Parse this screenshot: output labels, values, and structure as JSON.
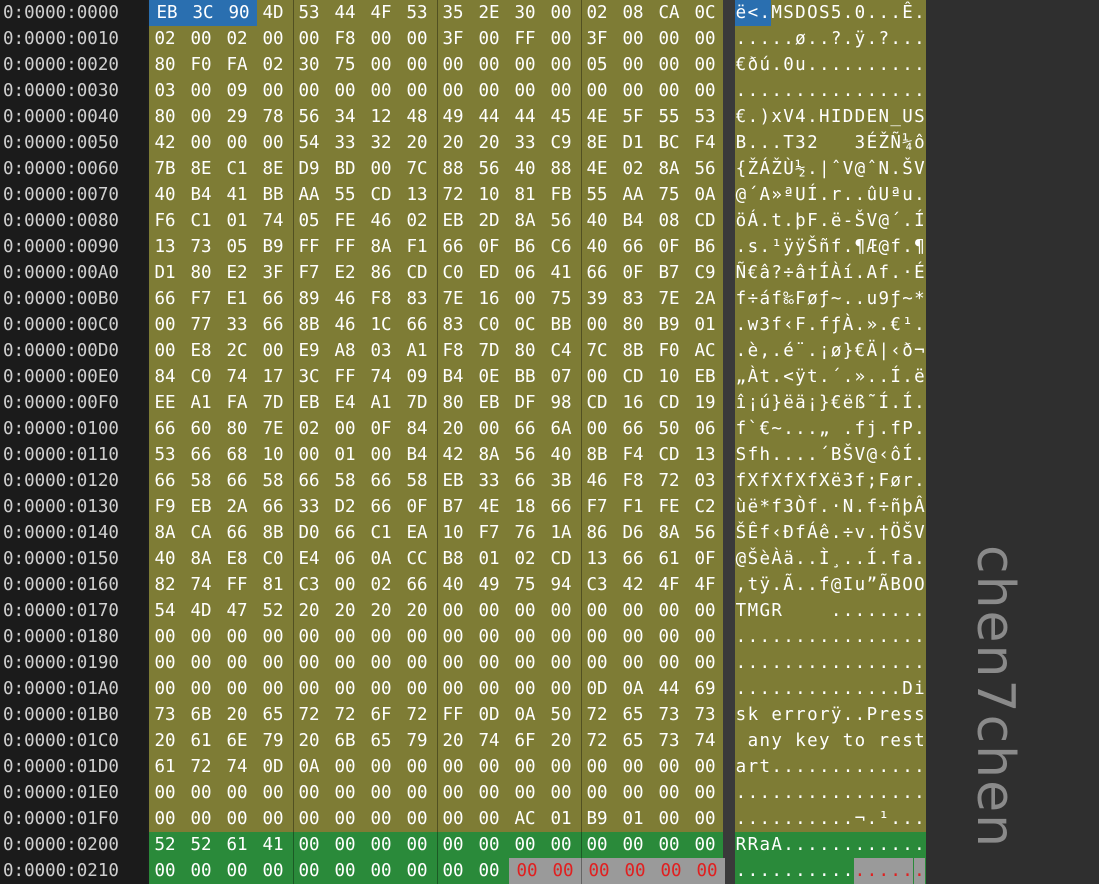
{
  "watermark": "chen7chen",
  "colors": {
    "data_bg": "#7e7c35",
    "header_bg": "#2a8a3a",
    "selection_bg": "#2a6fb0",
    "unsaved_bg": "#9a9a9a",
    "unsaved_text": "#e02020",
    "text": "#ffffff"
  },
  "rows": [
    {
      "addr": "0:0000:0000",
      "hex": [
        "EB",
        "3C",
        "90",
        "4D",
        "53",
        "44",
        "4F",
        "53",
        "35",
        "2E",
        "30",
        "00",
        "02",
        "08",
        "CA",
        "0C"
      ],
      "ascii": "ë<.MSDOS5.0...Ê."
    },
    {
      "addr": "0:0000:0010",
      "hex": [
        "02",
        "00",
        "02",
        "00",
        "00",
        "F8",
        "00",
        "00",
        "3F",
        "00",
        "FF",
        "00",
        "3F",
        "00",
        "00",
        "00"
      ],
      "ascii": ".....ø..?.ÿ.?..."
    },
    {
      "addr": "0:0000:0020",
      "hex": [
        "80",
        "F0",
        "FA",
        "02",
        "30",
        "75",
        "00",
        "00",
        "00",
        "00",
        "00",
        "00",
        "05",
        "00",
        "00",
        "00"
      ],
      "ascii": "€ðú.0u.........."
    },
    {
      "addr": "0:0000:0030",
      "hex": [
        "03",
        "00",
        "09",
        "00",
        "00",
        "00",
        "00",
        "00",
        "00",
        "00",
        "00",
        "00",
        "00",
        "00",
        "00",
        "00"
      ],
      "ascii": "................"
    },
    {
      "addr": "0:0000:0040",
      "hex": [
        "80",
        "00",
        "29",
        "78",
        "56",
        "34",
        "12",
        "48",
        "49",
        "44",
        "44",
        "45",
        "4E",
        "5F",
        "55",
        "53"
      ],
      "ascii": "€.)xV4.HIDDEN_US"
    },
    {
      "addr": "0:0000:0050",
      "hex": [
        "42",
        "00",
        "00",
        "00",
        "54",
        "33",
        "32",
        "20",
        "20",
        "20",
        "33",
        "C9",
        "8E",
        "D1",
        "BC",
        "F4"
      ],
      "ascii": "B...T32   3ÉŽÑ¼ô"
    },
    {
      "addr": "0:0000:0060",
      "hex": [
        "7B",
        "8E",
        "C1",
        "8E",
        "D9",
        "BD",
        "00",
        "7C",
        "88",
        "56",
        "40",
        "88",
        "4E",
        "02",
        "8A",
        "56"
      ],
      "ascii": "{ŽÁŽÙ½.|ˆV@ˆN.ŠV"
    },
    {
      "addr": "0:0000:0070",
      "hex": [
        "40",
        "B4",
        "41",
        "BB",
        "AA",
        "55",
        "CD",
        "13",
        "72",
        "10",
        "81",
        "FB",
        "55",
        "AA",
        "75",
        "0A"
      ],
      "ascii": "@´A»ªUÍ.r..ûUªu."
    },
    {
      "addr": "0:0000:0080",
      "hex": [
        "F6",
        "C1",
        "01",
        "74",
        "05",
        "FE",
        "46",
        "02",
        "EB",
        "2D",
        "8A",
        "56",
        "40",
        "B4",
        "08",
        "CD"
      ],
      "ascii": "öÁ.t.þF.ë-ŠV@´.Í"
    },
    {
      "addr": "0:0000:0090",
      "hex": [
        "13",
        "73",
        "05",
        "B9",
        "FF",
        "FF",
        "8A",
        "F1",
        "66",
        "0F",
        "B6",
        "C6",
        "40",
        "66",
        "0F",
        "B6"
      ],
      "ascii": ".s.¹ÿÿŠñf.¶Æ@f.¶"
    },
    {
      "addr": "0:0000:00A0",
      "hex": [
        "D1",
        "80",
        "E2",
        "3F",
        "F7",
        "E2",
        "86",
        "CD",
        "C0",
        "ED",
        "06",
        "41",
        "66",
        "0F",
        "B7",
        "C9"
      ],
      "ascii": "Ñ€â?÷â†ÍÀí.Af.·É"
    },
    {
      "addr": "0:0000:00B0",
      "hex": [
        "66",
        "F7",
        "E1",
        "66",
        "89",
        "46",
        "F8",
        "83",
        "7E",
        "16",
        "00",
        "75",
        "39",
        "83",
        "7E",
        "2A"
      ],
      "ascii": "f÷áf‰Føƒ~..u9ƒ~*"
    },
    {
      "addr": "0:0000:00C0",
      "hex": [
        "00",
        "77",
        "33",
        "66",
        "8B",
        "46",
        "1C",
        "66",
        "83",
        "C0",
        "0C",
        "BB",
        "00",
        "80",
        "B9",
        "01"
      ],
      "ascii": ".w3f‹F.fƒÀ.».€¹."
    },
    {
      "addr": "0:0000:00D0",
      "hex": [
        "00",
        "E8",
        "2C",
        "00",
        "E9",
        "A8",
        "03",
        "A1",
        "F8",
        "7D",
        "80",
        "C4",
        "7C",
        "8B",
        "F0",
        "AC"
      ],
      "ascii": ".è,.é¨.¡ø}€Ä|‹ð¬"
    },
    {
      "addr": "0:0000:00E0",
      "hex": [
        "84",
        "C0",
        "74",
        "17",
        "3C",
        "FF",
        "74",
        "09",
        "B4",
        "0E",
        "BB",
        "07",
        "00",
        "CD",
        "10",
        "EB"
      ],
      "ascii": "„Àt.<ÿt.´.»..Í.ë"
    },
    {
      "addr": "0:0000:00F0",
      "hex": [
        "EE",
        "A1",
        "FA",
        "7D",
        "EB",
        "E4",
        "A1",
        "7D",
        "80",
        "EB",
        "DF",
        "98",
        "CD",
        "16",
        "CD",
        "19"
      ],
      "ascii": "î¡ú}ëä¡}€ëß˜Í.Í."
    },
    {
      "addr": "0:0000:0100",
      "hex": [
        "66",
        "60",
        "80",
        "7E",
        "02",
        "00",
        "0F",
        "84",
        "20",
        "00",
        "66",
        "6A",
        "00",
        "66",
        "50",
        "06"
      ],
      "ascii": "f`€~...„ .fj.fP."
    },
    {
      "addr": "0:0000:0110",
      "hex": [
        "53",
        "66",
        "68",
        "10",
        "00",
        "01",
        "00",
        "B4",
        "42",
        "8A",
        "56",
        "40",
        "8B",
        "F4",
        "CD",
        "13"
      ],
      "ascii": "Sfh....´BŠV@‹ôÍ."
    },
    {
      "addr": "0:0000:0120",
      "hex": [
        "66",
        "58",
        "66",
        "58",
        "66",
        "58",
        "66",
        "58",
        "EB",
        "33",
        "66",
        "3B",
        "46",
        "F8",
        "72",
        "03"
      ],
      "ascii": "fXfXfXfXë3f;Før."
    },
    {
      "addr": "0:0000:0130",
      "hex": [
        "F9",
        "EB",
        "2A",
        "66",
        "33",
        "D2",
        "66",
        "0F",
        "B7",
        "4E",
        "18",
        "66",
        "F7",
        "F1",
        "FE",
        "C2"
      ],
      "ascii": "ùë*f3Òf.·N.f÷ñþÂ"
    },
    {
      "addr": "0:0000:0140",
      "hex": [
        "8A",
        "CA",
        "66",
        "8B",
        "D0",
        "66",
        "C1",
        "EA",
        "10",
        "F7",
        "76",
        "1A",
        "86",
        "D6",
        "8A",
        "56"
      ],
      "ascii": "ŠÊf‹ÐfÁê.÷v.†ÖŠV"
    },
    {
      "addr": "0:0000:0150",
      "hex": [
        "40",
        "8A",
        "E8",
        "C0",
        "E4",
        "06",
        "0A",
        "CC",
        "B8",
        "01",
        "02",
        "CD",
        "13",
        "66",
        "61",
        "0F"
      ],
      "ascii": "@ŠèÀä..Ì¸..Í.fa."
    },
    {
      "addr": "0:0000:0160",
      "hex": [
        "82",
        "74",
        "FF",
        "81",
        "C3",
        "00",
        "02",
        "66",
        "40",
        "49",
        "75",
        "94",
        "C3",
        "42",
        "4F",
        "4F"
      ],
      "ascii": "‚tÿ.Ã..f@Iu”ÃBOO"
    },
    {
      "addr": "0:0000:0170",
      "hex": [
        "54",
        "4D",
        "47",
        "52",
        "20",
        "20",
        "20",
        "20",
        "00",
        "00",
        "00",
        "00",
        "00",
        "00",
        "00",
        "00"
      ],
      "ascii": "TMGR    ........"
    },
    {
      "addr": "0:0000:0180",
      "hex": [
        "00",
        "00",
        "00",
        "00",
        "00",
        "00",
        "00",
        "00",
        "00",
        "00",
        "00",
        "00",
        "00",
        "00",
        "00",
        "00"
      ],
      "ascii": "................"
    },
    {
      "addr": "0:0000:0190",
      "hex": [
        "00",
        "00",
        "00",
        "00",
        "00",
        "00",
        "00",
        "00",
        "00",
        "00",
        "00",
        "00",
        "00",
        "00",
        "00",
        "00"
      ],
      "ascii": "................"
    },
    {
      "addr": "0:0000:01A0",
      "hex": [
        "00",
        "00",
        "00",
        "00",
        "00",
        "00",
        "00",
        "00",
        "00",
        "00",
        "00",
        "00",
        "0D",
        "0A",
        "44",
        "69"
      ],
      "ascii": "..............Di"
    },
    {
      "addr": "0:0000:01B0",
      "hex": [
        "73",
        "6B",
        "20",
        "65",
        "72",
        "72",
        "6F",
        "72",
        "FF",
        "0D",
        "0A",
        "50",
        "72",
        "65",
        "73",
        "73"
      ],
      "ascii": "sk errorÿ..Press"
    },
    {
      "addr": "0:0000:01C0",
      "hex": [
        "20",
        "61",
        "6E",
        "79",
        "20",
        "6B",
        "65",
        "79",
        "20",
        "74",
        "6F",
        "20",
        "72",
        "65",
        "73",
        "74"
      ],
      "ascii": " any key to rest"
    },
    {
      "addr": "0:0000:01D0",
      "hex": [
        "61",
        "72",
        "74",
        "0D",
        "0A",
        "00",
        "00",
        "00",
        "00",
        "00",
        "00",
        "00",
        "00",
        "00",
        "00",
        "00"
      ],
      "ascii": "art............."
    },
    {
      "addr": "0:0000:01E0",
      "hex": [
        "00",
        "00",
        "00",
        "00",
        "00",
        "00",
        "00",
        "00",
        "00",
        "00",
        "00",
        "00",
        "00",
        "00",
        "00",
        "00"
      ],
      "ascii": "................"
    },
    {
      "addr": "0:0000:01F0",
      "hex": [
        "00",
        "00",
        "00",
        "00",
        "00",
        "00",
        "00",
        "00",
        "00",
        "00",
        "AC",
        "01",
        "B9",
        "01",
        "00",
        "00"
      ],
      "ascii": "..........¬.¹..."
    },
    {
      "addr": "0:0000:0200",
      "hex": [
        "52",
        "52",
        "61",
        "41",
        "00",
        "00",
        "00",
        "00",
        "00",
        "00",
        "00",
        "00",
        "00",
        "00",
        "00",
        "00"
      ],
      "ascii": "RRaA............",
      "section": "header"
    },
    {
      "addr": "0:0000:0210",
      "hex": [
        "00",
        "00",
        "00",
        "00",
        "00",
        "00",
        "00",
        "00",
        "00",
        "00",
        "00",
        "00",
        "00",
        "00",
        "00",
        "00"
      ],
      "ascii": "................",
      "section": "header",
      "unsaved_from": 10
    }
  ]
}
